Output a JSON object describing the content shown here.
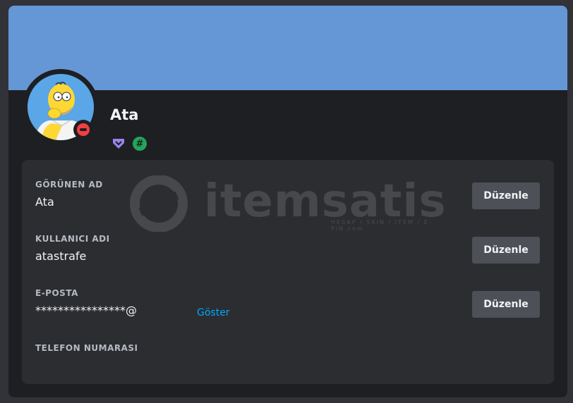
{
  "profile": {
    "username": "Ata",
    "banner_color": "#6597d6",
    "status": "do-not-disturb"
  },
  "badges": [
    {
      "name": "hypesquad-badge",
      "color": "#9b84ec"
    },
    {
      "name": "hashtag-badge",
      "glyph": "#",
      "color": "#23a55a"
    }
  ],
  "watermark": {
    "brand": "itemsatis",
    "tagline": "HESAP / SKIN / ITEM / E-PIN",
    "domain": ".com"
  },
  "fields": [
    {
      "label": "GÖRÜNEN AD",
      "value": "Ata",
      "button": "Düzenle"
    },
    {
      "label": "KULLANICI ADI",
      "value": "atastrafe",
      "button": "Düzenle"
    },
    {
      "label": "E-POSTA",
      "value": "****************@",
      "link": "Göster",
      "button": "Düzenle"
    },
    {
      "label": "TELEFON NUMARASI",
      "value": ""
    }
  ]
}
